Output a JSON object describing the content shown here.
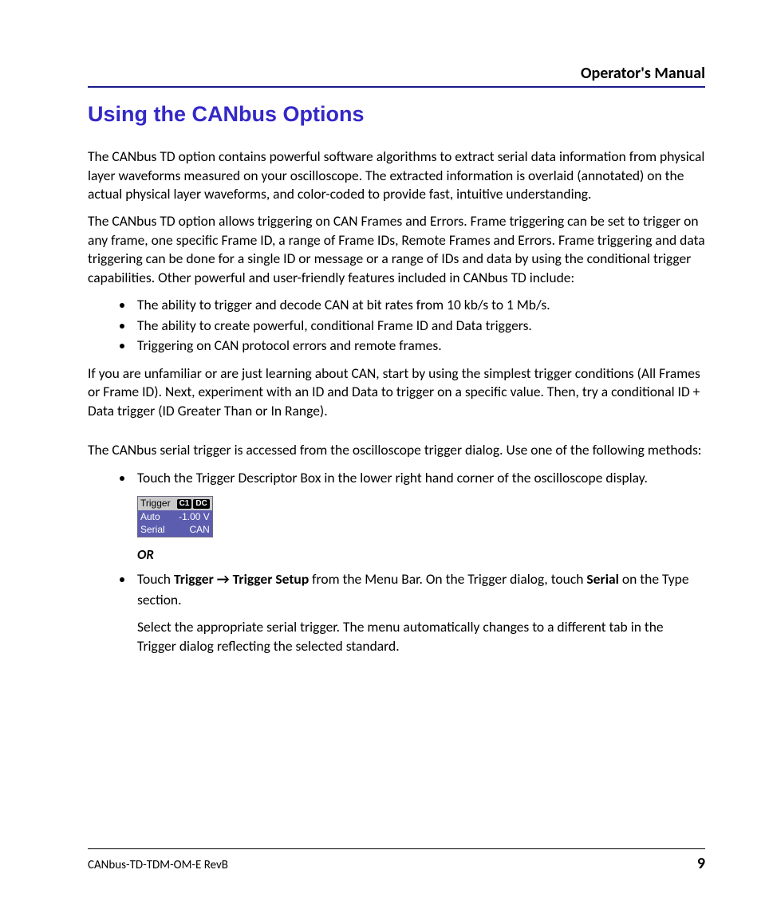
{
  "header": {
    "title": "Operator's Manual"
  },
  "h1": "Using the CANbus Options",
  "p1": "The CANbus TD option contains powerful software algorithms to extract serial data information from physical layer waveforms measured on your oscilloscope. The extracted information is overlaid (annotated) on the actual physical layer waveforms, and color-coded to provide fast, intuitive understanding.",
  "p2": "The CANbus TD option allows triggering on CAN Frames and Errors. Frame triggering can be set to trigger on any frame, one specific Frame ID, a range of Frame IDs, Remote Frames and Errors. Frame triggering and data triggering can be done for a single ID or message or a range of IDs and data by using the conditional trigger capabilities. Other powerful and user-friendly features included in CANbus TD include:",
  "features": [
    "The ability to trigger and decode CAN at bit rates from 10 kb/s to 1 Mb/s.",
    "The ability to create powerful, conditional Frame ID and Data triggers.",
    "Triggering on CAN protocol errors and remote frames."
  ],
  "p3": "If you are unfamiliar or are just learning about CAN, start by using the simplest trigger conditions (All Frames or Frame ID). Next, experiment with an ID and Data to trigger on a specific value. Then, try a conditional ID + Data trigger (ID Greater Than or In Range).",
  "p4": "The CANbus serial trigger is accessed from the oscilloscope trigger dialog. Use one of the following methods:",
  "method1": "Touch the Trigger Descriptor Box in the lower right hand corner of the oscilloscope display.",
  "or_label": "OR",
  "method2": {
    "pre": "Touch ",
    "b1": "Trigger → Trigger Setup",
    "mid": " from the Menu Bar. On the Trigger dialog, touch ",
    "b2": "Serial",
    "post": " on the Type section."
  },
  "method2_p2": "Select the appropriate serial trigger. The menu automatically changes to a different tab in the Trigger dialog reflecting the selected standard.",
  "trigger_box": {
    "row1_left": "Trigger",
    "row1_badge1": "C1",
    "row1_badge2": "DC",
    "row2_left": "Auto",
    "row2_right": "-1.00 V",
    "row3_left": "Serial",
    "row3_right": "CAN"
  },
  "footer": {
    "doc_id": "CANbus-TD-TDM-OM-E RevB",
    "page_num": "9"
  }
}
